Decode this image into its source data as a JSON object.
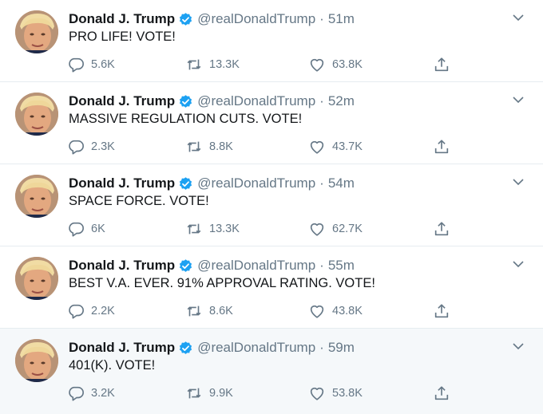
{
  "colors": {
    "verified": "#1da1f2",
    "secondary_text": "#657786",
    "divider": "#e6ecf0",
    "hover_background": "#f5f8fa"
  },
  "icons": {
    "reply": "reply-icon",
    "retweet": "retweet-icon",
    "like": "like-icon",
    "share": "share-icon",
    "verified": "verified-badge-icon",
    "menu": "chevron-down-icon"
  },
  "tweets": [
    {
      "name": "Donald J. Trump",
      "handle": "@realDonaldTrump",
      "sep": "·",
      "time": "51m",
      "text": "PRO LIFE! VOTE!",
      "replies": "5.6K",
      "retweets": "13.3K",
      "likes": "63.8K"
    },
    {
      "name": "Donald J. Trump",
      "handle": "@realDonaldTrump",
      "sep": "·",
      "time": "52m",
      "text": "MASSIVE REGULATION CUTS. VOTE!",
      "replies": "2.3K",
      "retweets": "8.8K",
      "likes": "43.7K"
    },
    {
      "name": "Donald J. Trump",
      "handle": "@realDonaldTrump",
      "sep": "·",
      "time": "54m",
      "text": "SPACE FORCE. VOTE!",
      "replies": "6K",
      "retweets": "13.3K",
      "likes": "62.7K"
    },
    {
      "name": "Donald J. Trump",
      "handle": "@realDonaldTrump",
      "sep": "·",
      "time": "55m",
      "text": "BEST V.A. EVER. 91% APPROVAL RATING. VOTE!",
      "replies": "2.2K",
      "retweets": "8.6K",
      "likes": "43.8K"
    },
    {
      "name": "Donald J. Trump",
      "handle": "@realDonaldTrump",
      "sep": "·",
      "time": "59m",
      "text": "401(K). VOTE!",
      "replies": "3.2K",
      "retweets": "9.9K",
      "likes": "53.8K"
    }
  ]
}
